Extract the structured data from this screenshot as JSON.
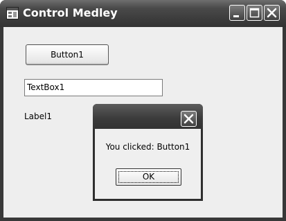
{
  "window": {
    "title": "Control Medley",
    "icon": "window-form-icon",
    "caption_buttons": [
      "minimize-icon",
      "maximize-icon",
      "close-icon"
    ]
  },
  "form": {
    "button1_label": "Button1",
    "textbox1_value": "TextBox1",
    "label1_text": "Label1"
  },
  "message_box": {
    "message": "You clicked: Button1",
    "ok_label": "OK",
    "close_icon": "close-icon"
  }
}
